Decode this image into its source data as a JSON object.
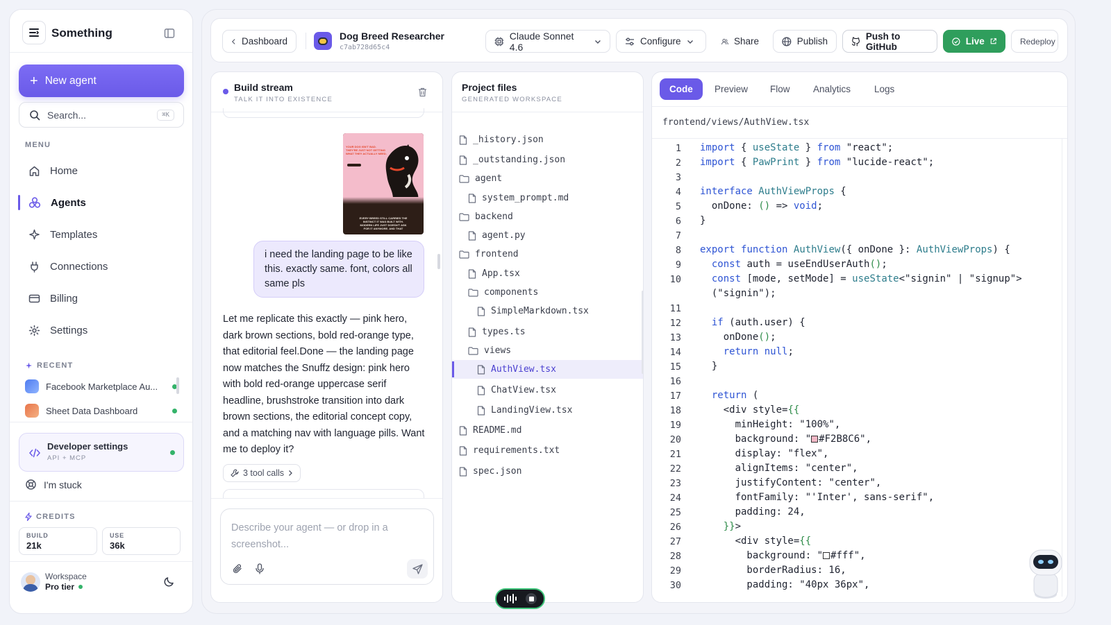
{
  "sidebar": {
    "app_name": "Something",
    "new_agent": "New agent",
    "search_placeholder": "Search...",
    "search_kbd": "⌘K",
    "menu_label": "MENU",
    "nav": [
      {
        "label": "Home",
        "icon": "home-icon"
      },
      {
        "label": "Agents",
        "icon": "agents-icon",
        "active": true
      },
      {
        "label": "Templates",
        "icon": "sparkle-icon"
      },
      {
        "label": "Connections",
        "icon": "plug-icon"
      },
      {
        "label": "Billing",
        "icon": "card-icon"
      },
      {
        "label": "Settings",
        "icon": "gear-icon"
      }
    ],
    "recent_label": "RECENT",
    "recent": [
      {
        "label": "Facebook Marketplace Au...",
        "color": "#4f7cf0"
      },
      {
        "label": "Sheet Data Dashboard",
        "color": "#e8744a"
      }
    ],
    "dev_settings": {
      "title": "Developer settings",
      "sub": "API + MCP"
    },
    "stuck": "I'm stuck",
    "credits_label": "CREDITS",
    "credits": [
      {
        "key": "BUILD",
        "value": "21k"
      },
      {
        "key": "USE",
        "value": "36k"
      }
    ],
    "workspace": {
      "name": "Workspace",
      "tier": "Pro tier"
    }
  },
  "topbar": {
    "back": "Dashboard",
    "project_name": "Dog Breed Researcher",
    "project_id": "c7ab728d65c4",
    "model": "Claude Sonnet 4.6",
    "configure": "Configure",
    "share": "Share",
    "publish": "Publish",
    "push": "Push to GitHub",
    "live": "Live",
    "redeploy": "Redeploy"
  },
  "build_stream": {
    "title": "Build stream",
    "sub": "TALK IT INTO EXISTENCE",
    "preview_lines": [
      "YOUR DOG ISN'T BAD.",
      "THEY'RE JUST NOT GETTING",
      "WHAT THEY ACTUALLY NEED."
    ],
    "preview_caption": [
      "EVERY BREED STILL CARRIES THE",
      "INSTINCT IT WAS BUILT WITH.",
      "MODERN LIFE JUST DOESN'T ASK",
      "FOR IT ANYMORE. AND THAT"
    ],
    "user_msg": "i need the landing page to be like this. exactly same. font, colors all same pls",
    "assistant_msg": "Let me replicate this exactly — pink hero, dark brown sections, bold red-orange type, that editorial feel.Done — the landing page now matches the Snuffz design: pink hero with bold red-orange uppercase serif headline, brushstroke transition into dark brown sections, the editorial concept copy, and a matching nav with language pills. Want me to deploy it?",
    "tool_calls": "3 tool calls",
    "composer_placeholder": "Describe your agent — or drop in a screenshot..."
  },
  "project_files": {
    "title": "Project files",
    "sub": "GENERATED WORKSPACE",
    "items": [
      {
        "name": "_history.json",
        "type": "file",
        "depth": 0
      },
      {
        "name": "_outstanding.json",
        "type": "file",
        "depth": 0
      },
      {
        "name": "agent",
        "type": "folder",
        "depth": 0
      },
      {
        "name": "system_prompt.md",
        "type": "file",
        "depth": 1
      },
      {
        "name": "backend",
        "type": "folder",
        "depth": 0
      },
      {
        "name": "agent.py",
        "type": "file",
        "depth": 1
      },
      {
        "name": "frontend",
        "type": "folder",
        "depth": 0
      },
      {
        "name": "App.tsx",
        "type": "file",
        "depth": 1
      },
      {
        "name": "components",
        "type": "folder",
        "depth": 1
      },
      {
        "name": "SimpleMarkdown.tsx",
        "type": "file",
        "depth": 2
      },
      {
        "name": "types.ts",
        "type": "file",
        "depth": 1
      },
      {
        "name": "views",
        "type": "folder",
        "depth": 1
      },
      {
        "name": "AuthView.tsx",
        "type": "file",
        "depth": 2,
        "selected": true
      },
      {
        "name": "ChatView.tsx",
        "type": "file",
        "depth": 2
      },
      {
        "name": "LandingView.tsx",
        "type": "file",
        "depth": 2
      },
      {
        "name": "README.md",
        "type": "file",
        "depth": 0
      },
      {
        "name": "requirements.txt",
        "type": "file",
        "depth": 0
      },
      {
        "name": "spec.json",
        "type": "file",
        "depth": 0
      }
    ]
  },
  "editor": {
    "tabs": [
      "Code",
      "Preview",
      "Flow",
      "Analytics",
      "Logs"
    ],
    "active_tab": "Code",
    "path": "frontend/views/AuthView.tsx",
    "line_numbers": [
      "1",
      "2",
      "3",
      "4",
      "5",
      "6",
      "7",
      "8",
      "9",
      "10",
      "",
      "11",
      "12",
      "13",
      "14",
      "15",
      "16",
      "17",
      "18",
      "19",
      "20",
      "21",
      "22",
      "23",
      "24",
      "25",
      "26",
      "27",
      "28",
      "29",
      "30"
    ],
    "lines": [
      "import { useState } from \"react\";",
      "import { PawPrint } from \"lucide-react\";",
      "",
      "interface AuthViewProps {",
      "  onDone: () => void;",
      "}",
      "",
      "export function AuthView({ onDone }: AuthViewProps) {",
      "  const auth = useEndUserAuth();",
      "  const [mode, setMode] = useState<\"signin\" | \"signup\">",
      "  (\"signin\");",
      "",
      "  if (auth.user) {",
      "    onDone();",
      "    return null;",
      "  }",
      "",
      "  return (",
      "    <div style={{",
      "      minHeight: \"100%\",",
      "      background: \"#F2B8C6\",",
      "      display: \"flex\",",
      "      alignItems: \"center\",",
      "      justifyContent: \"center\",",
      "      fontFamily: \"'Inter', sans-serif\",",
      "      padding: 24,",
      "    }}>",
      "      <div style={{",
      "        background: \"#fff\",",
      "        borderRadius: 16,",
      "        padding: \"40px 36px\","
    ],
    "swatch_colors": {
      "20": "#F2B8C6",
      "28": "#ffffff"
    }
  },
  "colors": {
    "accent": "#6a5ae8",
    "live": "#2f9e5c"
  }
}
